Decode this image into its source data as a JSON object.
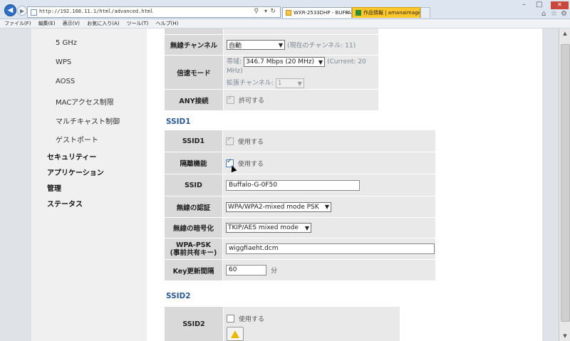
{
  "browser": {
    "address": "http://192.168.11.1/html/advanced.html",
    "tabs": [
      {
        "label": "WXR-2533DHP - BUFFAL...",
        "active": true
      },
      {
        "label": "作品情報 | amanaimages",
        "active": false
      }
    ]
  },
  "menu": [
    "ファイル(F)",
    "編集(E)",
    "表示(V)",
    "お気に入り(A)",
    "ツール(T)",
    "ヘルプ(H)"
  ],
  "sidebar": {
    "sub_items": [
      "5 GHz",
      "WPS",
      "AOSS",
      "MACアクセス制限",
      "マルチキャスト制御",
      "ゲストポート"
    ],
    "main_items": [
      "セキュリティー",
      "アプリケーション",
      "管理",
      "ステータス"
    ]
  },
  "radio": {
    "channel_label": "無線チャンネル",
    "channel_value": "自動",
    "channel_note": "(現在のチャンネル: 11)",
    "speed_label": "倍速モード",
    "bandwidth_prefix": "帯域:",
    "bandwidth_value": "346.7 Mbps (20 MHz)",
    "bandwidth_note": "(Current: 20 MHz)",
    "ext_channel_label": "拡張チャンネル:",
    "ext_channel_value": "1",
    "any_label": "ANY接続",
    "any_check": "許可する"
  },
  "ssid1": {
    "heading": "SSID1",
    "enable_label": "SSID1",
    "enable_check": "使用する",
    "isolate_label": "隔離機能",
    "isolate_check": "使用する",
    "ssid_label": "SSID",
    "ssid_value": "Buffalo-G-0F50",
    "auth_label": "無線の認証",
    "auth_value": "WPA/WPA2-mixed mode PSK",
    "enc_label": "無線の暗号化",
    "enc_value": "TKIP/AES mixed mode",
    "psk_label_1": "WPA-PSK",
    "psk_label_2": "(事前共有キー)",
    "psk_value": "wiggfiaeht.dcm",
    "key_label": "Key更新間隔",
    "key_value": "60",
    "key_unit": "分"
  },
  "ssid2": {
    "heading": "SSID2",
    "enable_label": "SSID2",
    "enable_check": "使用する"
  }
}
